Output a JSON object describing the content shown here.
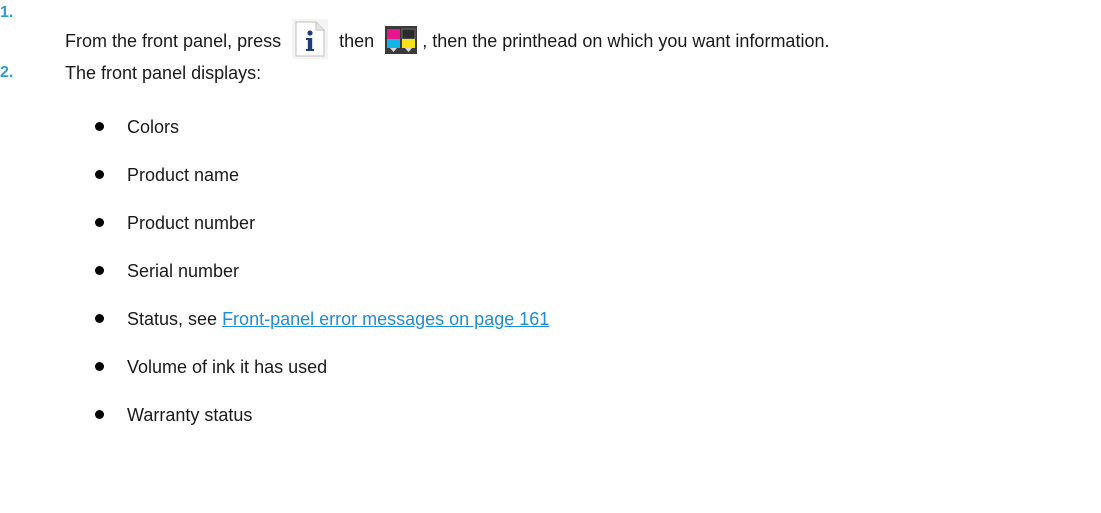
{
  "steps": [
    {
      "number": "1.",
      "text_before_info_icon": "From the front panel, press",
      "text_before_printhead_icon": "then",
      "text_after_icons": ", then the printhead on which you want information.",
      "icons": [
        "info-icon",
        "printhead-icon"
      ]
    },
    {
      "number": "2.",
      "text": "The front panel displays:"
    }
  ],
  "display_items": [
    {
      "text": "Colors"
    },
    {
      "text": "Product name"
    },
    {
      "text": "Product number"
    },
    {
      "text": "Serial number"
    },
    {
      "text": "Status, see ",
      "link_text": "Front-panel error messages on page 161"
    },
    {
      "text": "Volume of ink it has used"
    },
    {
      "text": "Warranty status"
    }
  ],
  "colors": {
    "step_number": "#2a9fd6",
    "link": "#1f8dd6",
    "body_text": "#1a1a1a"
  }
}
